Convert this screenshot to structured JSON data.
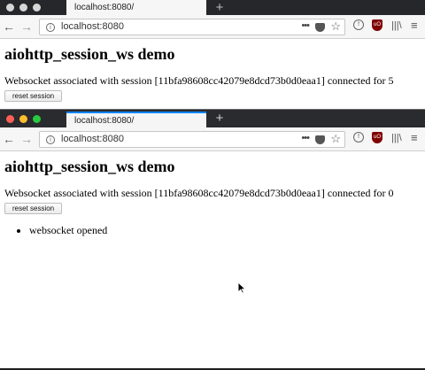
{
  "window1": {
    "tab_title": "localhost:8080/",
    "new_tab": "+",
    "url": "localhost:8080",
    "page": {
      "heading": "aiohttp_session_ws demo",
      "status": "Websocket associated with session [11bfa98608cc42079e8dcd73b0d0eaa1] connected for 5",
      "reset_label": "reset session"
    }
  },
  "window2": {
    "tab_title": "localhost:8080/",
    "new_tab": "+",
    "url": "localhost:8080",
    "page": {
      "heading": "aiohttp_session_ws demo",
      "status": "Websocket associated with session [11bfa98608cc42079e8dcd73b0d0eaa1] connected for 0",
      "reset_label": "reset session",
      "messages": [
        "websocket opened"
      ]
    }
  },
  "icons": {
    "back": "arrow-left-icon",
    "forward": "arrow-right-icon",
    "info": "info-icon",
    "page_actions": "more-icon",
    "pocket": "pocket-icon",
    "bookmark": "star-icon",
    "reader": "reader-icon",
    "ublock": "ublock-icon",
    "library": "library-icon",
    "menu": "hamburger-menu-icon"
  },
  "colors": {
    "tabbar_dark": "#26272a",
    "active_tab_accent": "#0a84ff",
    "close_red": "#fe5f57",
    "minimize_yellow": "#febc2e",
    "zoom_green": "#29c840"
  }
}
